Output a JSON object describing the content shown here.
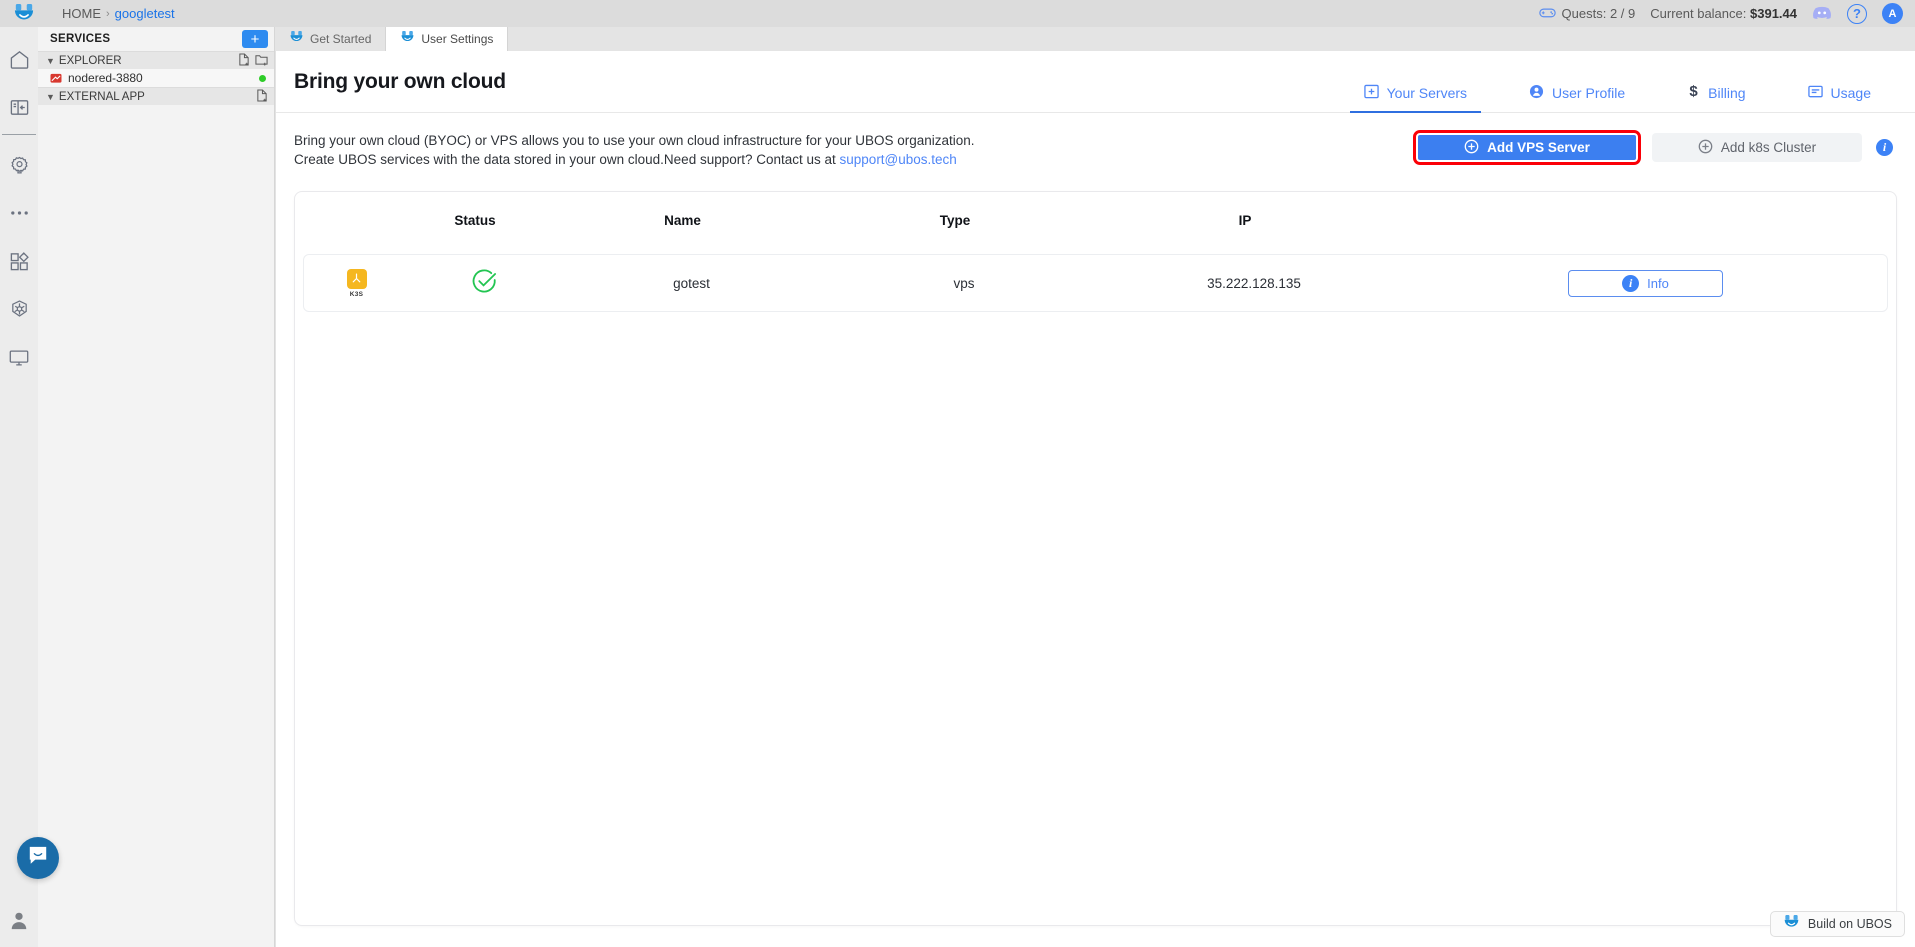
{
  "topbar": {
    "logo_icon": "ubos-smiley-logo",
    "breadcrumb": {
      "home": "HOME",
      "separator": "›",
      "current": "googletest"
    },
    "quests": {
      "icon": "gamepad-icon",
      "label": "Quests: 2 / 9"
    },
    "balance_label": "Current balance:",
    "balance_value": "$391.44",
    "discord_icon": "discord-icon",
    "help_icon": "help-circle-icon",
    "avatar_initial": "A"
  },
  "rail": {
    "items": [
      {
        "icon": "home-icon",
        "name": "rail-item-home"
      },
      {
        "icon": "panel-layout-icon",
        "name": "rail-item-panel"
      },
      {
        "icon": "gear-settings-icon",
        "name": "rail-item-settings"
      },
      {
        "icon": "ellipsis-icon",
        "name": "rail-item-more"
      },
      {
        "icon": "apps-grid-icon",
        "name": "rail-item-apps"
      },
      {
        "icon": "kubernetes-icon",
        "name": "rail-item-kubernetes"
      },
      {
        "icon": "monitor-icon",
        "name": "rail-item-monitor"
      }
    ],
    "bottom_icon": "user-account-icon"
  },
  "sidebar": {
    "title": "SERVICES",
    "add_label": "+",
    "sections": [
      {
        "label": "EXPLORER",
        "icons": [
          "new-file-icon",
          "new-folder-icon"
        ],
        "items": [
          {
            "label": "nodered-3880",
            "icon": "node-red-icon",
            "status": "online"
          }
        ]
      },
      {
        "label": "EXTERNAL APP",
        "icons": [
          "new-file-icon"
        ],
        "items": []
      }
    ]
  },
  "tabstrip": {
    "tabs": [
      {
        "label": "Get Started",
        "icon": "ubos-smiley-icon",
        "active": false
      },
      {
        "label": "User Settings",
        "icon": "ubos-smiley-icon",
        "active": true
      }
    ]
  },
  "page": {
    "title": "Bring your own cloud",
    "nav_tabs": [
      {
        "label": "Your Servers",
        "icon": "server-box-icon",
        "active": true
      },
      {
        "label": "User Profile",
        "icon": "user-profile-icon",
        "active": false
      },
      {
        "label": "Billing",
        "icon": "dollar-sign-icon",
        "active": false
      },
      {
        "label": "Usage",
        "icon": "usage-list-icon",
        "active": false
      }
    ],
    "description_text": "Bring your own cloud (BYOC) or VPS allows you to use your own cloud infrastructure for your UBOS organization. Create UBOS services with the data stored in your own cloud.Need support? Contact us at ",
    "description_link": "support@ubos.tech",
    "actions": {
      "primary_label": "Add VPS Server",
      "primary_icon": "plus-circle-icon",
      "primary_highlight_color": "#fb0007",
      "secondary_label": "Add k8s Cluster",
      "secondary_icon": "plus-circle-icon",
      "info_icon": "info-circle-icon"
    }
  },
  "table": {
    "columns": [
      "",
      "Status",
      "Name",
      "Type",
      "IP",
      ""
    ],
    "rows": [
      {
        "badge_label": "K3S",
        "badge_color": "#f5b720",
        "status": "healthy",
        "name": "gotest",
        "type": "vps",
        "ip": "35.222.128.135",
        "action_label": "Info",
        "action_icon": "info-circle-icon"
      }
    ]
  },
  "floating": {
    "intercom_icon": "chat-bubble-smile-icon",
    "build_badge_label": "Build on UBOS",
    "build_badge_icon": "ubos-smiley-icon"
  }
}
